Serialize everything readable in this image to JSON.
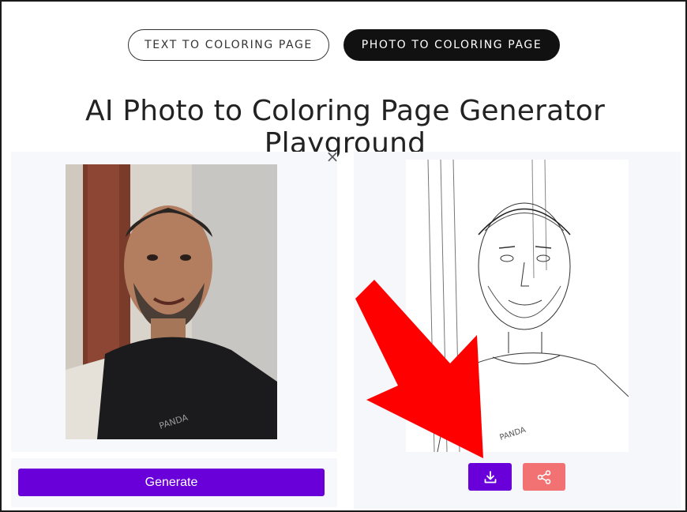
{
  "tabs": {
    "text_to_coloring": "TEXT TO COLORING PAGE",
    "photo_to_coloring": "PHOTO TO COLORING PAGE"
  },
  "page_title": "AI Photo to Coloring Page Generator Playground",
  "actions": {
    "generate_label": "Generate",
    "close_glyph": "×",
    "download_icon": "download-icon",
    "share_icon": "share-icon"
  },
  "colors": {
    "primary": "#6a00d9",
    "share": "#f27172",
    "annotation_arrow": "#ff0000"
  }
}
